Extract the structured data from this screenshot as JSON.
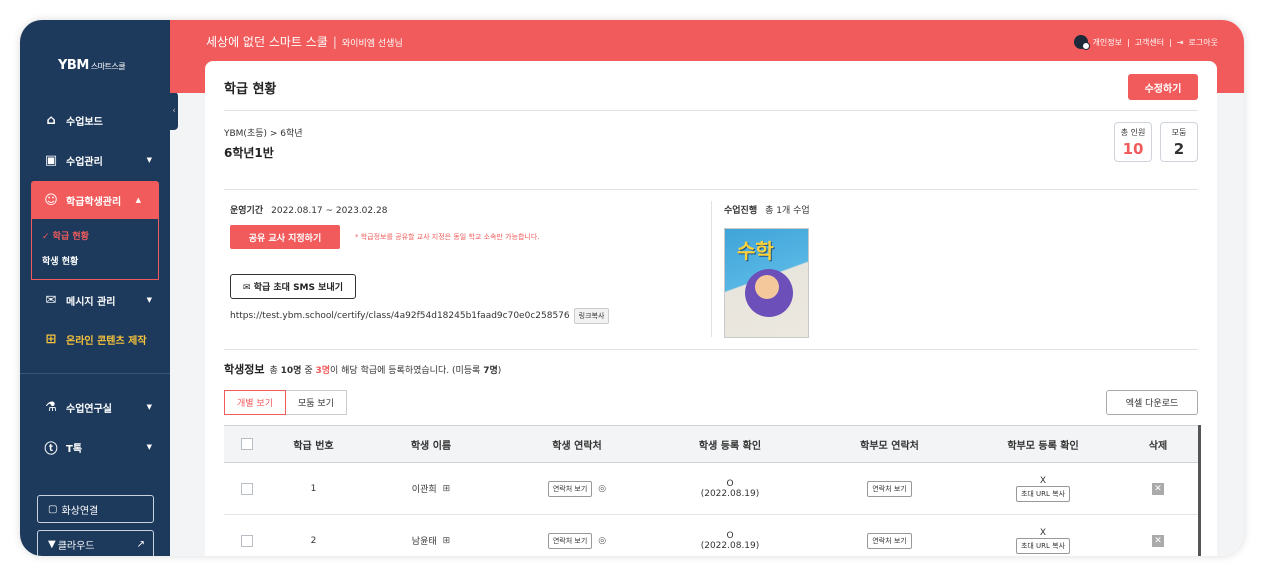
{
  "sidebar": {
    "logo": "YBM",
    "logo_sub": "스마트스쿨",
    "items": [
      {
        "label": "수업보드",
        "icon": "book-open-icon"
      },
      {
        "label": "수업관리",
        "icon": "chalkboard-icon"
      },
      {
        "label": "학급학생관리",
        "icon": "people-icon"
      },
      {
        "label": "메시지 관리",
        "icon": "chat-icon"
      },
      {
        "label": "온라인 콘텐츠 제작",
        "icon": "monitor-plus-icon"
      },
      {
        "label": "수업연구실",
        "icon": "microscope-icon"
      },
      {
        "label": "T톡",
        "icon": "t-circle-icon"
      }
    ],
    "submenu": [
      {
        "label": "✓ 학급 현황"
      },
      {
        "label": "학생 현황"
      }
    ],
    "buttons": [
      {
        "label": "화상연결",
        "icon": "video-icon"
      },
      {
        "label": "클라우드",
        "icon": "cloud-icon"
      }
    ]
  },
  "topbar": {
    "title": "세상에 없던 스마트 스쿨",
    "user": "와이비엠 선생님",
    "links": [
      "개인정보",
      "고객센터",
      "로그아웃"
    ]
  },
  "page": {
    "title": "학급 현황",
    "edit_button": "수정하기",
    "breadcrumb": "YBM(초등) > 6학년",
    "class_name": "6학년1반",
    "stats": {
      "total_label": "총 인원",
      "total_value": "10",
      "group_label": "모둠",
      "group_value": "2"
    },
    "period_label": "운영기간",
    "period_value": "2022.08.17 ~ 2023.02.28",
    "share_button": "공유 교사 지정하기",
    "share_note": "* 학급정보를 공유할 교사 지정은 동일 학교 소속만 가능합니다.",
    "sms_button": "✉ 학급 초대 SMS 보내기",
    "url": "https://test.ybm.school/certify/class/4a92f54d18245b1faad9c70e0c258576",
    "copy_link": "링크복사",
    "progress_label": "수업진행",
    "progress_value": "총 1개 수업",
    "book_title": "수학",
    "student_info": {
      "head": "학생정보",
      "p1": "총 ",
      "total": "10명",
      "p2": " 중 ",
      "registered": "3명",
      "p3": "이 해당 학급에 등록하였습니다. (미등록 ",
      "unregistered": "7명",
      "p4": ")"
    },
    "tabs": [
      "개별 보기",
      "모둠 보기"
    ],
    "excel_button": "엑셀 다운로드"
  },
  "table": {
    "headers": [
      "학급 번호",
      "학생 이름",
      "학생 연락처",
      "학생 등록 확인",
      "학부모 연락처",
      "학부모 등록 확인",
      "삭제"
    ],
    "rows": [
      {
        "no": "1",
        "name": "이관희",
        "contact_btn": "연락처 보기",
        "reg": "O",
        "reg_date": "(2022.08.19)",
        "parent_btn": "연락처 보기",
        "parent_reg": "X",
        "invite_btn": "초대 URL 복사"
      },
      {
        "no": "2",
        "name": "남윤태",
        "contact_btn": "연락처 보기",
        "reg": "O",
        "reg_date": "(2022.08.19)",
        "parent_btn": "연락처 보기",
        "parent_reg": "X",
        "invite_btn": "초대 URL 복사"
      }
    ]
  },
  "colors": {
    "accent": "#f25b5b",
    "sidebar": "#1d3a5c",
    "online": "#f5c23b"
  }
}
